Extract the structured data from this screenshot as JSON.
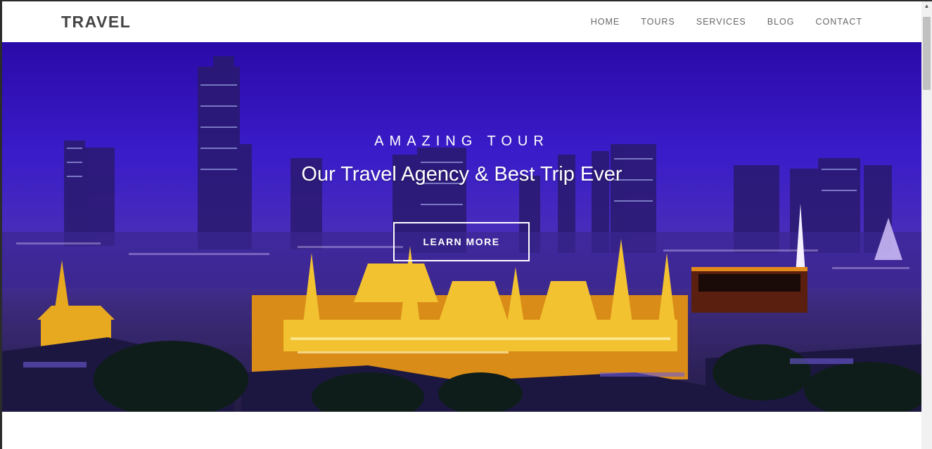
{
  "navbar": {
    "brand": "TRAVEL",
    "items": [
      {
        "label": "HOME"
      },
      {
        "label": "TOURS"
      },
      {
        "label": "SERVICES"
      },
      {
        "label": "BLOG"
      },
      {
        "label": "CONTACT"
      }
    ]
  },
  "hero": {
    "eyebrow": "AMAZING TOUR",
    "headline": "Our Travel Agency & Best Trip Ever",
    "cta_label": "LEARN MORE"
  },
  "colors": {
    "brand_text": "#444444",
    "nav_text": "#666666",
    "hero_sky": "#3a1cc9",
    "hero_text": "#ffffff",
    "temple_gold": "#f2c230"
  },
  "scrollbar": {
    "up_arrow_icon": "triangle-up-icon"
  }
}
